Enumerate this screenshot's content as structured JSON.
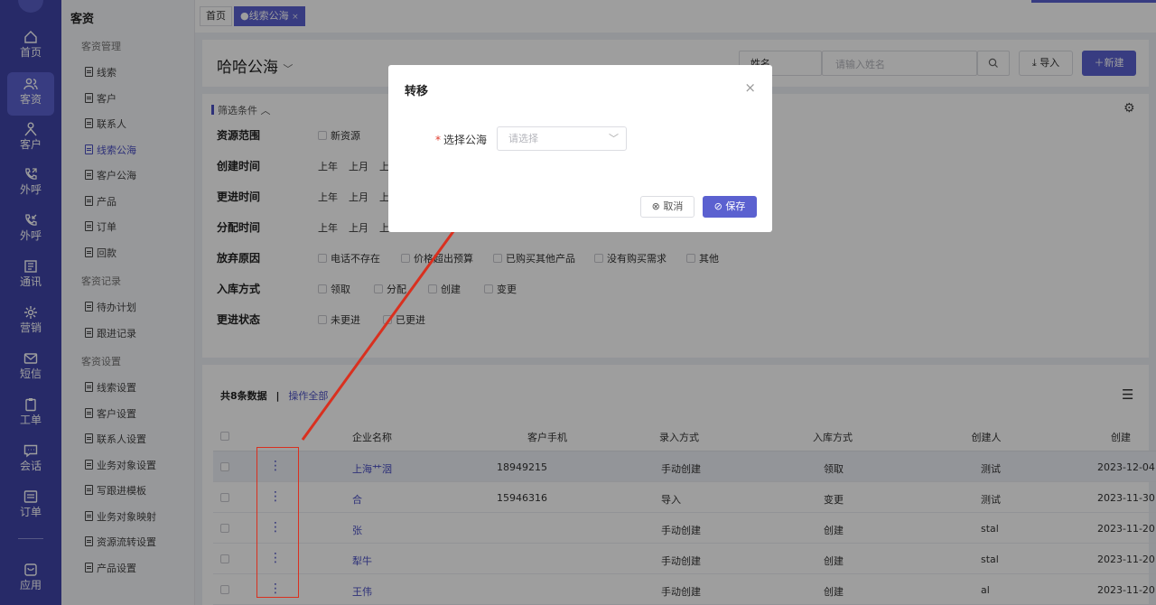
{
  "rail": {
    "items": [
      {
        "label": "首页",
        "icon": "home-icon"
      },
      {
        "label": "客资",
        "icon": "users-icon",
        "active": true
      },
      {
        "label": "客户",
        "icon": "person-icon"
      },
      {
        "label": "外呼",
        "icon": "phone-out-icon"
      },
      {
        "label": "外呼",
        "icon": "phone-in-icon"
      },
      {
        "label": "通讯",
        "icon": "address-book-icon"
      },
      {
        "label": "营销",
        "icon": "gear-icon"
      },
      {
        "label": "短信",
        "icon": "envelope-icon"
      },
      {
        "label": "工单",
        "icon": "clipboard-icon"
      },
      {
        "label": "会话",
        "icon": "chat-icon"
      },
      {
        "label": "订单",
        "icon": "order-icon"
      },
      {
        "label": "应用",
        "icon": "app-icon"
      }
    ]
  },
  "sidebar": {
    "title": "客资",
    "groups": [
      {
        "label": "客资管理",
        "items": [
          "线索",
          "客户",
          "联系人",
          "线索公海",
          "客户公海",
          "产品",
          "订单",
          "回款"
        ]
      },
      {
        "label": "客资记录",
        "items": [
          "待办计划",
          "跟进记录"
        ]
      },
      {
        "label": "客资设置",
        "items": [
          "线索设置",
          "客户设置",
          "联系人设置",
          "业务对象设置",
          "写跟进模板",
          "业务对象映射",
          "资源流转设置",
          "产品设置"
        ]
      }
    ],
    "active_item": "线索公海"
  },
  "tabs": {
    "home": "首页",
    "active": "线索公海",
    "close": "×"
  },
  "header": {
    "title": "哈哈公海",
    "search_field_type": "姓名",
    "search_placeholder": "请输入姓名",
    "import_label": "导入",
    "new_label": "新建"
  },
  "filters": {
    "heading": "筛选条件",
    "rows": [
      {
        "label": "资源范围",
        "options": [
          "新资源"
        ]
      },
      {
        "label": "创建时间",
        "options": [
          "上年",
          "上月",
          "上"
        ]
      },
      {
        "label": "更进时间",
        "options": [
          "上年",
          "上月",
          "上"
        ]
      },
      {
        "label": "分配时间",
        "options": [
          "上年",
          "上月",
          "上"
        ]
      },
      {
        "label": "放弃原因",
        "options": [
          "电话不存在",
          "价格超出预算",
          "已购买其他产品",
          "没有购买需求",
          "其他"
        ]
      },
      {
        "label": "入库方式",
        "options": [
          "领取",
          "分配",
          "创建",
          "变更"
        ]
      },
      {
        "label": "更进状态",
        "options": [
          "未更进",
          "已更进"
        ]
      }
    ]
  },
  "table": {
    "summary": "共8条数据",
    "separator": "|",
    "operate_all": "操作全部",
    "columns": [
      "企业名称",
      "客户手机",
      "录入方式",
      "入库方式",
      "创建人",
      "创建"
    ],
    "rows": [
      {
        "company": "上海艹𣲷",
        "phone": "18949215",
        "entry": "手动创建",
        "storage": "领取",
        "creator": "测试",
        "created": "2023-12-04"
      },
      {
        "company": "合",
        "phone": "15946316",
        "entry": "导入",
        "storage": "变更",
        "creator": "测试",
        "created": "2023-11-30"
      },
      {
        "company": "张",
        "phone": "",
        "entry": "手动创建",
        "storage": "创建",
        "creator": "stal",
        "created": "2023-11-20"
      },
      {
        "company": "犁牛",
        "phone": "",
        "entry": "手动创建",
        "storage": "创建",
        "creator": "stal",
        "created": "2023-11-20"
      },
      {
        "company": "王伟",
        "phone": "",
        "entry": "手动创建",
        "storage": "创建",
        "creator": "al",
        "created": "2023-11-20"
      }
    ]
  },
  "dialog": {
    "title": "转移",
    "close": "×",
    "field_label": "选择公海",
    "required_mark": "*",
    "select_placeholder": "请选择",
    "cancel_label": "取消",
    "save_label": "保存"
  },
  "colors": {
    "brand": "#3f44a8",
    "accent": "#5b61d0",
    "annotation": "#d9301f"
  }
}
